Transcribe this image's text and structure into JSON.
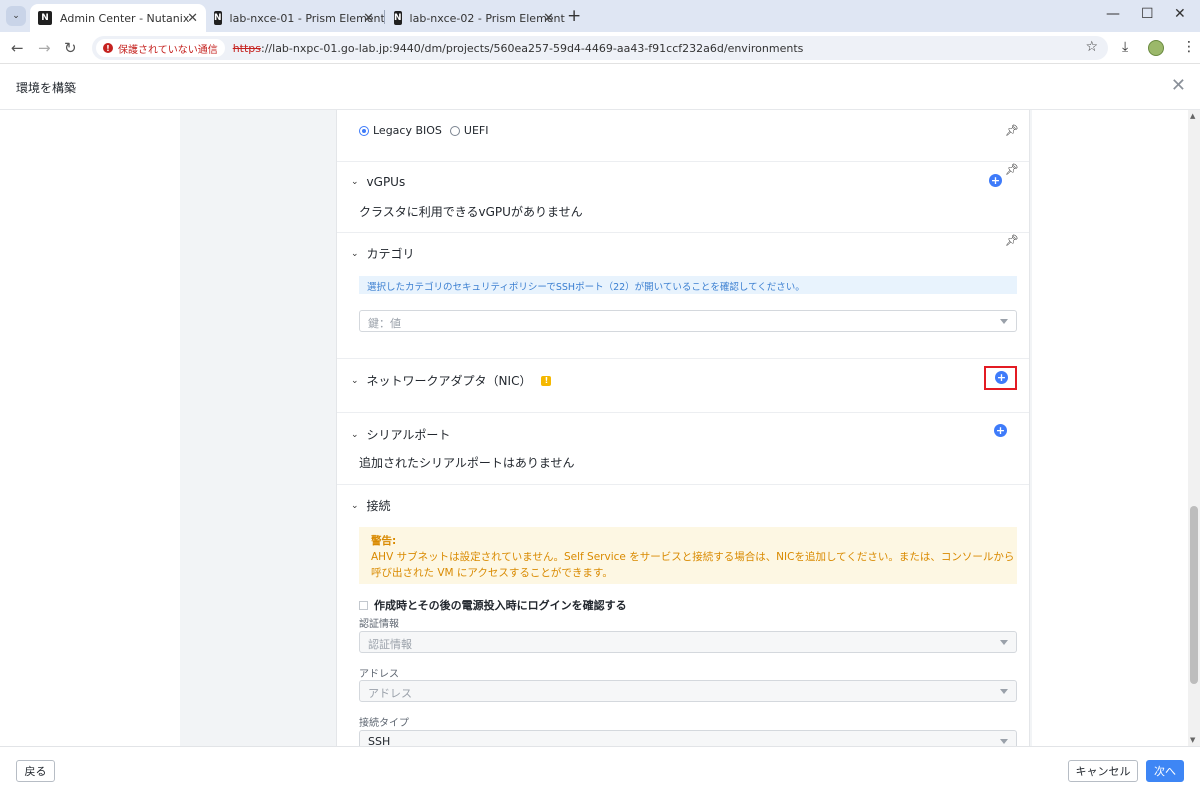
{
  "browser": {
    "tabs": [
      {
        "title": "Admin Center - Nutanix",
        "active": true
      },
      {
        "title": "lab-nxce-01 - Prism Element",
        "active": false
      },
      {
        "title": "lab-nxce-02 - Prism Element",
        "active": false
      }
    ],
    "security_label": "保護されていない通信",
    "url_scheme": "https",
    "url_rest": "://lab-nxpc-01.go-lab.jp:9440/dm/projects/560ea257-59d4-4469-aa43-f91ccf232a6d/environments"
  },
  "header": {
    "title": "環境を構築"
  },
  "boot": {
    "options": [
      "Legacy BIOS",
      "UEFI"
    ],
    "selected": "Legacy BIOS"
  },
  "sections": {
    "vgpus": {
      "title": "vGPUs",
      "empty_text": "クラスタに利用できるvGPUがありません"
    },
    "categories": {
      "title": "カテゴリ",
      "info": "選択したカテゴリのセキュリティポリシーでSSHポート（22）が開いていることを確認してください。",
      "placeholder": "鍵：値"
    },
    "nic": {
      "title": "ネットワークアダプタ（NIC）",
      "badge": "!"
    },
    "serial": {
      "title": "シリアルポート",
      "empty_text": "追加されたシリアルポートはありません"
    },
    "connection": {
      "title": "接続",
      "warning_title": "警告:",
      "warning_line1": "AHV サブネットは設定されていません。Self Service をサービスと接続する場合は、NICを追加してください。または、コンソールから",
      "warning_line2": "呼び出された VM にアクセスすることができます。",
      "check_label": "作成時とその後の電源投入時にログインを確認する",
      "credential_label": "認証情報",
      "credential_placeholder": "認証情報",
      "address_label": "アドレス",
      "address_placeholder": "アドレス",
      "conn_type_label": "接続タイプ",
      "conn_type_value": "SSH"
    }
  },
  "footer": {
    "back": "戻る",
    "cancel": "キャンセル",
    "next": "次へ"
  }
}
